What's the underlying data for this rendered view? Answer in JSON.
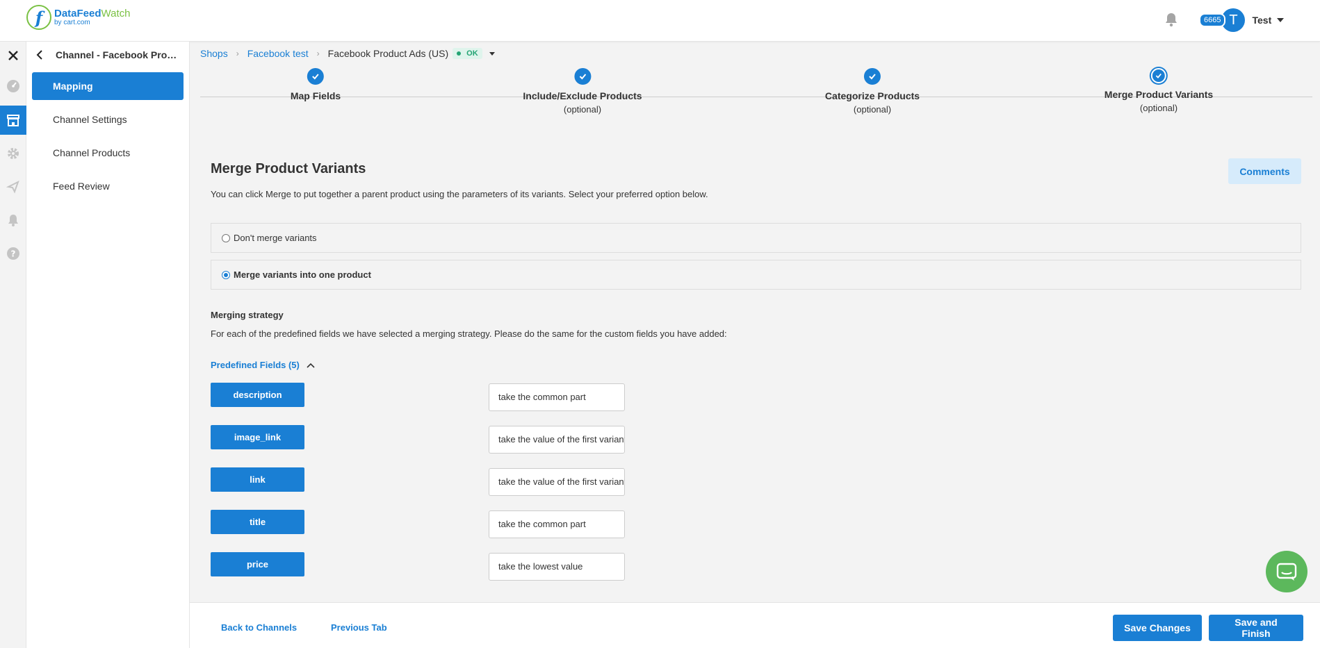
{
  "app": {
    "logo_main_1": "DataFeed",
    "logo_main_2": "Watch",
    "logo_sub": "by cart.com",
    "logo_icon": "f-logo-icon"
  },
  "header": {
    "notification_count": "6665",
    "avatar_initial": "T",
    "username": "Test"
  },
  "rail": {
    "icons": [
      "close-icon",
      "dashboard-icon",
      "shop-icon",
      "gear-icon",
      "send-icon",
      "bell-icon",
      "help-icon"
    ]
  },
  "sidebar": {
    "title": "Channel - Facebook Produ...",
    "items": [
      {
        "label": "Mapping"
      },
      {
        "label": "Channel Settings"
      },
      {
        "label": "Channel Products"
      },
      {
        "label": "Feed Review"
      }
    ]
  },
  "breadcrumb": {
    "shops": "Shops",
    "shop_name": "Facebook test",
    "channel": "Facebook Product Ads (US)",
    "status": "OK"
  },
  "stepper": {
    "steps": [
      {
        "label": "Map Fields",
        "sub": ""
      },
      {
        "label": "Include/Exclude Products",
        "sub": "(optional)"
      },
      {
        "label": "Categorize Products",
        "sub": "(optional)"
      },
      {
        "label": "Merge Product Variants",
        "sub": "(optional)"
      }
    ]
  },
  "content": {
    "title": "Merge Product Variants",
    "comments_label": "Comments",
    "intro": "You can click Merge to put together a parent product using the parameters of its variants. Select your preferred option below.",
    "option_no_merge": "Don't merge variants",
    "option_merge": "Merge variants into one product",
    "strategy_title": "Merging strategy",
    "strategy_desc": "For each of the predefined fields we have selected a merging strategy. Please do the same for the custom fields you have added:",
    "predefined_label": "Predefined Fields (5)",
    "fields": [
      {
        "name": "description",
        "strategy": "take the common part"
      },
      {
        "name": "image_link",
        "strategy": "take the value of the first variant"
      },
      {
        "name": "link",
        "strategy": "take the value of the first variant"
      },
      {
        "name": "title",
        "strategy": "take the common part"
      },
      {
        "name": "price",
        "strategy": "take the lowest value"
      }
    ]
  },
  "footer": {
    "back": "Back to Channels",
    "previous": "Previous Tab",
    "save": "Save Changes",
    "save_finish": "Save and Finish"
  },
  "colors": {
    "primary": "#1a7fd4",
    "success": "#24a474",
    "chat": "#5cb85c"
  }
}
